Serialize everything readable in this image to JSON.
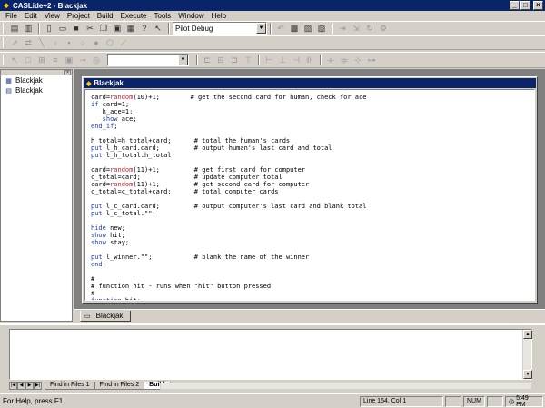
{
  "window": {
    "title": "CASLide+2 - Blackjak",
    "min_glyph": "_",
    "max_glyph": "□",
    "close_glyph": "×"
  },
  "menu": [
    "File",
    "Edit",
    "View",
    "Project",
    "Build",
    "Execute",
    "Tools",
    "Window",
    "Help"
  ],
  "toolbar": {
    "config_select": "Pilot Debug",
    "drop_arrow": "▼"
  },
  "project_tree": {
    "items": [
      "Blackjak",
      "Blackjak"
    ]
  },
  "editor": {
    "title": "Blackjak",
    "tab_label": "Blackjak",
    "lines": [
      "card=random(10)+1;        # get the second card for human, check for ace",
      "if card=1;",
      "   h_ace=1;",
      "   show ace;",
      "end_if;",
      "",
      "h_total=h_total+card;      # total the human's cards",
      "put l_h_card.card;         # output human's last card and total",
      "put l_h_total.h_total;",
      "",
      "card=random(11)+1;         # get first card for computer",
      "c_total=card;              # update computer total",
      "card=random(11)+1;         # get second card for computer",
      "c_total=c_total+card;      # total computer cards",
      "",
      "put l_c_card.card;         # output computer's last card and blank total",
      "put l_c_total.\"\";",
      "",
      "hide new;",
      "show hit;",
      "show stay;",
      "",
      "put l_winner.\"\";           # blank the name of the winner",
      "end;",
      "",
      "#",
      "# function hit - runs when \"hit\" button pressed",
      "#",
      "function hit;"
    ]
  },
  "output_tabs": [
    "Find in Files 1",
    "Find in Files 2",
    "Build"
  ],
  "output_tabs_active": "Build",
  "output_nav": {
    "first": "|◀",
    "prev": "◀",
    "next": "▶",
    "last": "▶|"
  },
  "status": {
    "message": "For Help, press F1",
    "position": "Line 154, Col 1",
    "num": "NUM",
    "time": "5:49 PM"
  }
}
